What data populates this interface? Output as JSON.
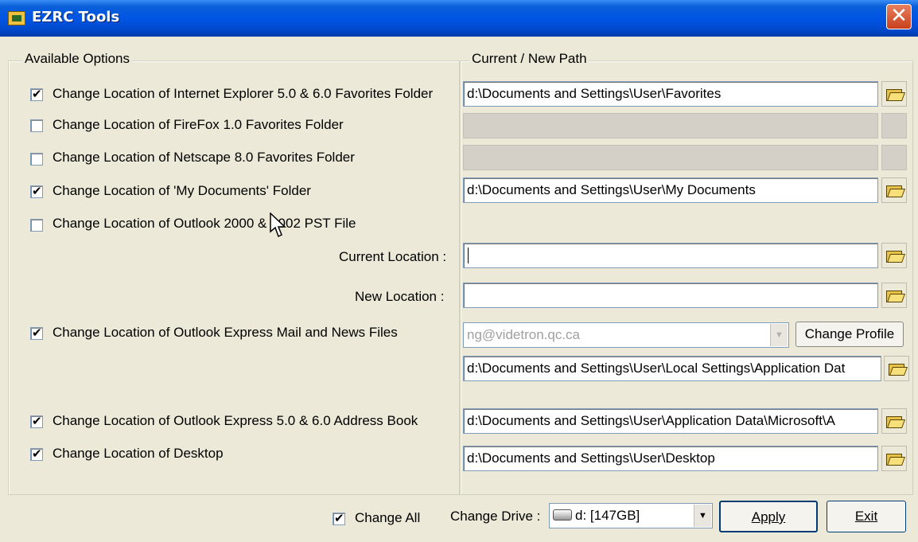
{
  "window": {
    "title": "EZRC Tools",
    "close_glyph": "✕"
  },
  "groups": {
    "options_label": "Available Options",
    "path_label": "Current / New Path"
  },
  "options": [
    {
      "label": "Change Location of Internet Explorer 5.0 & 6.0 Favorites Folder",
      "checked": true,
      "path": "d:\\Documents and Settings\\User\\Favorites",
      "enabled": true
    },
    {
      "label": "Change Location of FireFox 1.0  Favorites Folder",
      "checked": false,
      "path": "",
      "enabled": false
    },
    {
      "label": "Change Location of Netscape 8.0 Favorites Folder",
      "checked": false,
      "path": "",
      "enabled": false
    },
    {
      "label": "Change Location of 'My Documents' Folder",
      "checked": true,
      "path": "d:\\Documents and Settings\\User\\My Documents",
      "enabled": true
    },
    {
      "label": "Change Location of Outlook 2000 & 2002 PST File",
      "checked": false
    },
    {
      "label": "Change Location of Outlook Express Mail and News Files",
      "checked": true,
      "path": "d:\\Documents and Settings\\User\\Local Settings\\Application Dat"
    },
    {
      "label": "Change Location of Outlook Express 5.0 & 6.0 Address Book",
      "checked": true,
      "path": "d:\\Documents and Settings\\User\\Application Data\\Microsoft\\A"
    },
    {
      "label": "Change Location of Desktop",
      "checked": true,
      "path": "d:\\Documents and Settings\\User\\Desktop"
    }
  ],
  "outlook_pst": {
    "current_label": "Current Location :",
    "current_value": "",
    "new_label": "New Location :",
    "new_value": ""
  },
  "outlook_express": {
    "profile_value": "ng@videtron.qc.ca",
    "change_profile_label": "Change Profile"
  },
  "footer": {
    "change_all_label": "Change All",
    "change_all_checked": true,
    "change_drive_label": "Change Drive :",
    "drive_value": "d: [147GB]",
    "apply_label": "Apply",
    "exit_label": "Exit"
  },
  "icons": {
    "folder": "folder-open-icon",
    "drive": "hard-drive-icon",
    "dropdown": "chevron-down-icon",
    "close": "close-icon",
    "app": "app-icon"
  },
  "colors": {
    "titlebar": "#0055e5",
    "dialog_bg": "#ece9d8",
    "close_button": "#c8401c",
    "disabled_field": "#d4d0c8"
  }
}
